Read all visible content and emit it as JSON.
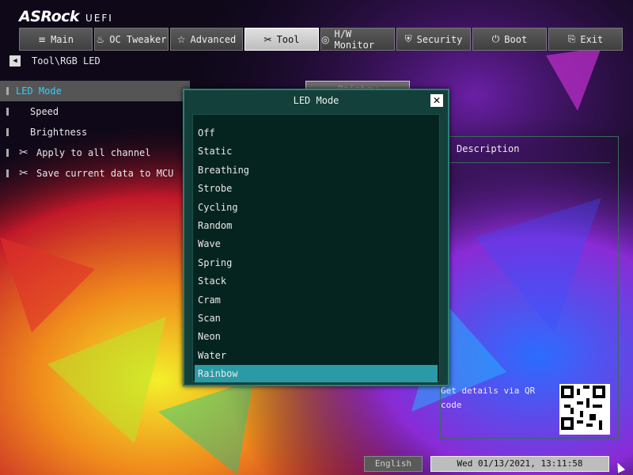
{
  "header": {
    "brand": "ASRock",
    "sub": "UEFI"
  },
  "tabs": [
    {
      "label": "Main",
      "icon": "≡",
      "active": false
    },
    {
      "label": "OC Tweaker",
      "icon": "♨",
      "active": false
    },
    {
      "label": "Advanced",
      "icon": "☆",
      "active": false
    },
    {
      "label": "Tool",
      "icon": "✂",
      "active": true
    },
    {
      "label": "H/W Monitor",
      "icon": "◎",
      "active": false
    },
    {
      "label": "Security",
      "icon": "⛨",
      "active": false
    },
    {
      "label": "Boot",
      "icon": "⏻",
      "active": false
    },
    {
      "label": "Exit",
      "icon": "⎘",
      "active": false
    }
  ],
  "breadcrumb": {
    "path": "Tool\\RGB LED",
    "back_icon": "◀"
  },
  "menu": [
    {
      "label": "LED Mode",
      "selected": true
    },
    {
      "label": "Speed",
      "selected": false
    },
    {
      "label": "Brightness",
      "selected": false
    },
    {
      "label": "Apply to all channel",
      "selected": false,
      "icon": "wrench-icon"
    },
    {
      "label": "Save current data to MCU",
      "selected": false,
      "icon": "wrench-icon"
    }
  ],
  "value_box": "Rainbow",
  "description": {
    "title": "Description",
    "qr_text": "Get details via QR code"
  },
  "dialog": {
    "title": "LED Mode",
    "close_icon": "✕",
    "options": [
      "Off",
      "Static",
      "Breathing",
      "Strobe",
      "Cycling",
      "Random",
      "Wave",
      "Spring",
      "Stack",
      "Cram",
      "Scan",
      "Neon",
      "Water",
      "Rainbow"
    ],
    "selected": "Rainbow"
  },
  "footer": {
    "language": "English",
    "datetime": "Wed 01/13/2021, 13:11:58"
  },
  "colors": {
    "accent": "#2ad2ff",
    "dialog_bg": "#13403a",
    "selected_option": "#2a9aa6"
  }
}
